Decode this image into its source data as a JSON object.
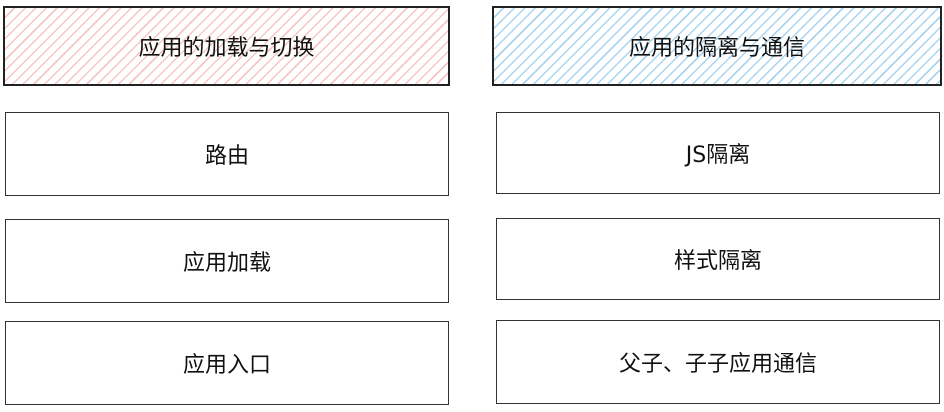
{
  "columns": {
    "left": {
      "header": "应用的加载与切换",
      "items": [
        "路由",
        "应用加载",
        "应用入口"
      ],
      "hatch_color": "#f6c6c6"
    },
    "right": {
      "header": "应用的隔离与通信",
      "items": [
        "JS隔离",
        "样式隔离",
        "父子、子子应用通信"
      ],
      "hatch_color": "#a9d4f0"
    }
  }
}
